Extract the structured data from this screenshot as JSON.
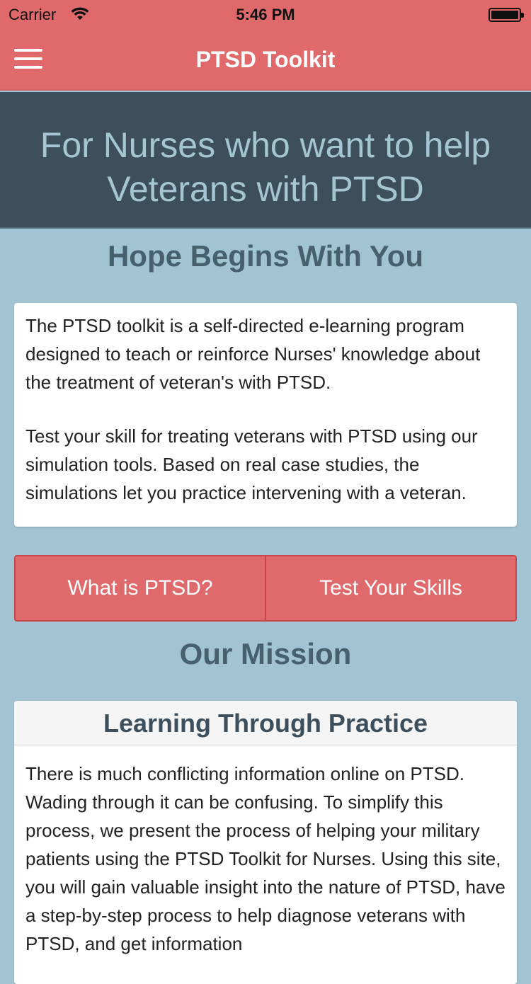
{
  "status": {
    "carrier": "Carrier",
    "time": "5:46 PM"
  },
  "nav": {
    "title": "PTSD Toolkit",
    "menu_icon": "hamburger-icon"
  },
  "hero": {
    "title": "For Nurses who want to help Veterans with PTSD"
  },
  "tagline": "Hope Begins With You",
  "intro": {
    "paragraph1": "The PTSD toolkit is a self-directed e-learning program designed to teach or reinforce Nurses' knowledge about the treatment of veteran's with PTSD.",
    "paragraph2": "Test your skill for treating veterans with PTSD using our simulation tools. Based on real case studies, the simulations let you practice intervening with a veteran."
  },
  "buttons": {
    "what_is_ptsd": "What is PTSD?",
    "test_skills": "Test Your Skills"
  },
  "mission": {
    "title": "Our Mission",
    "card_title": "Learning Through Practice",
    "body": "There is much conflicting information online on PTSD. Wading through it can be confusing. To simplify this process, we present the process of helping your military patients using the PTSD Toolkit for Nurses. Using this site, you will gain valuable insight into the nature of PTSD, have a step-by-step process to help diagnose veterans with PTSD, and get information"
  },
  "colors": {
    "brand": "#e06a6b",
    "hero_bg": "#3d4f5c",
    "page_bg": "#a2c4d2",
    "heading_text": "#46606e"
  }
}
